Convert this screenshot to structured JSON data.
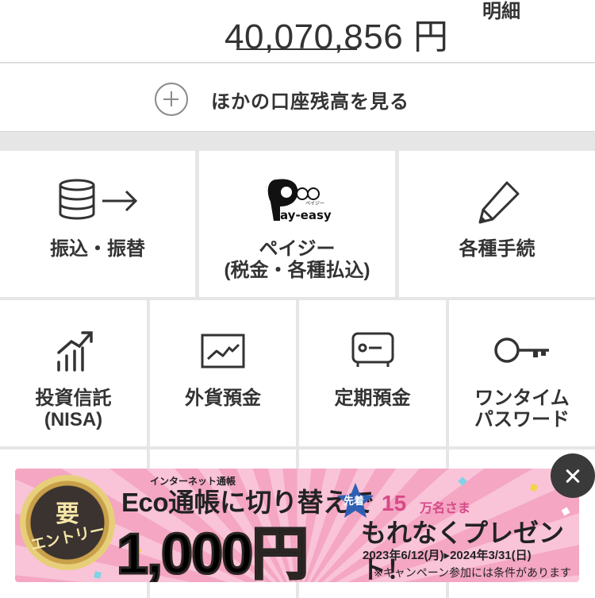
{
  "balance": {
    "amount": "40,070,856",
    "unit": "円",
    "details_label": "明細"
  },
  "other_accounts": {
    "label": "ほかの口座残高を見る",
    "icon": "plus-circle-icon"
  },
  "menu_row1": [
    {
      "label": "振込・振替",
      "icon": "database-transfer-icon"
    },
    {
      "label_line1": "ペイジー",
      "label_line2": "(税金・各種払込)",
      "icon": "payeasy-logo",
      "logo_caption": "ペイジー",
      "logo_text": "ay-easy"
    },
    {
      "label": "各種手続",
      "icon": "pencil-icon"
    }
  ],
  "menu_row2": [
    {
      "label_line1": "投資信託",
      "label_line2": "(NISA)",
      "icon": "growth-chart-icon"
    },
    {
      "label": "外貨預金",
      "icon": "line-chart-icon"
    },
    {
      "label": "定期預金",
      "icon": "safe-icon"
    },
    {
      "label_line1": "ワンタイム",
      "label_line2": "パスワード",
      "icon": "key-icon"
    }
  ],
  "banner": {
    "seal_top": "要",
    "seal_bottom": "エントリー",
    "sub": "インターネット通帳",
    "headline": "Eco通帳に切り替えで",
    "star_text": "先着",
    "count": "15",
    "count_suffix": "万名さま",
    "amount": "1,000円",
    "tagline": "もれなくプレゼント！",
    "period": "2023年6/12(月)▸2024年3/31(日)",
    "note": "※キャンペーン参加には条件があります"
  },
  "close_button": {
    "icon": "close-icon"
  },
  "colors": {
    "background": "#e6e6e6",
    "tile": "#ffffff",
    "text": "#333333",
    "banner_pink": "#f4a6c3",
    "accent_pink": "#d64a88",
    "close_bg": "#3a3a3a"
  }
}
